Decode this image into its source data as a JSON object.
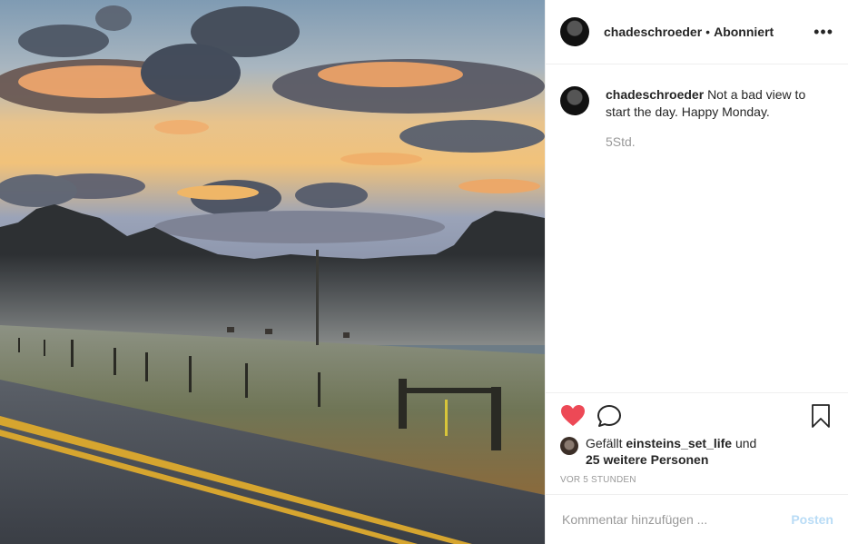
{
  "post": {
    "username": "chadeschroeder",
    "separator": "•",
    "follow_status": "Abonniert",
    "more_icon": "more-horizontal-icon"
  },
  "caption": {
    "username": "chadeschroeder",
    "text": "Not a bad view to start the day. Happy Monday.",
    "time": "5Std."
  },
  "likes": {
    "prefix": "Gefällt",
    "user": "einsteins_set_life",
    "connector": "und",
    "others": "25 weitere Personen"
  },
  "timestamp": "VOR 5 STUNDEN",
  "comment_box": {
    "placeholder": "Kommentar hinzufügen ...",
    "post_label": "Posten"
  },
  "colors": {
    "like": "#ed4956",
    "post_disabled": "#b9dcf6",
    "muted": "#999999",
    "text": "#262626"
  }
}
